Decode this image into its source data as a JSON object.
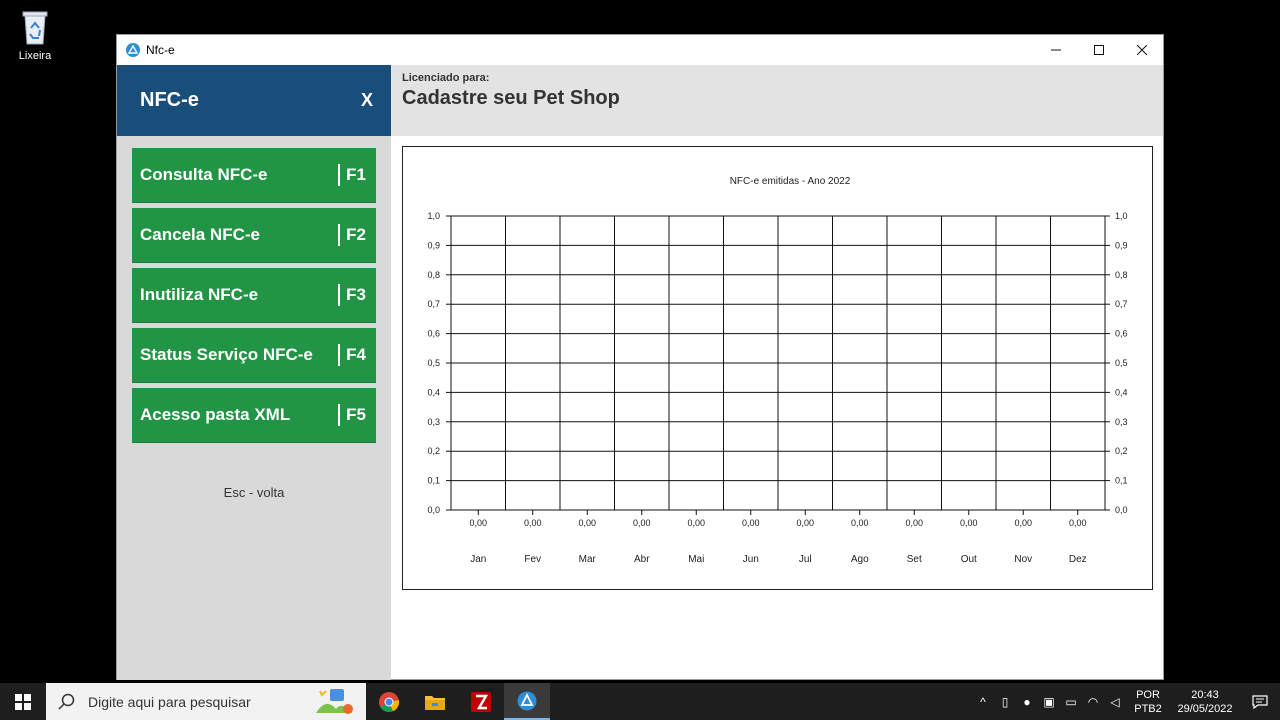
{
  "desktop": {
    "recycle_bin_label": "Lixeira"
  },
  "window": {
    "title": "Nfc-e",
    "controls": {
      "minimize": "—",
      "maximize": "☐",
      "close": "✕"
    }
  },
  "sidebar": {
    "title": "NFC-e",
    "close_label": "X",
    "items": [
      {
        "label": "Consulta NFC-e",
        "key": "F1"
      },
      {
        "label": "Cancela NFC-e",
        "key": "F2"
      },
      {
        "label": "Inutiliza NFC-e",
        "key": "F3"
      },
      {
        "label": "Status Serviço NFC-e",
        "key": "F4"
      },
      {
        "label": "Acesso pasta XML",
        "key": "F5"
      }
    ],
    "footer": "Esc - volta"
  },
  "header": {
    "licensed_label": "Licenciado para:",
    "shop_name": "Cadastre seu Pet Shop"
  },
  "chart_data": {
    "type": "bar",
    "title": "NFC-e emitidas - Ano 2022",
    "categories": [
      "Jan",
      "Fev",
      "Mar",
      "Abr",
      "Mai",
      "Jun",
      "Jul",
      "Ago",
      "Set",
      "Out",
      "Nov",
      "Dez"
    ],
    "values": [
      0,
      0,
      0,
      0,
      0,
      0,
      0,
      0,
      0,
      0,
      0,
      0
    ],
    "value_labels": [
      "0,00",
      "0,00",
      "0,00",
      "0,00",
      "0,00",
      "0,00",
      "0,00",
      "0,00",
      "0,00",
      "0,00",
      "0,00",
      "0,00"
    ],
    "yticks": [
      "0,0",
      "0,1",
      "0,2",
      "0,3",
      "0,4",
      "0,5",
      "0,6",
      "0,7",
      "0,8",
      "0,9",
      "1,0"
    ],
    "ylim": [
      0,
      1
    ],
    "grid": true,
    "xlabel": "",
    "ylabel": ""
  },
  "taskbar": {
    "search_placeholder": "Digite aqui para pesquisar",
    "language_line1": "POR",
    "language_line2": "PTB2",
    "time": "20:43",
    "date": "29/05/2022",
    "apps": [
      "chrome-icon",
      "file-explorer-icon",
      "filezilla-icon",
      "nfce-app-icon"
    ]
  }
}
